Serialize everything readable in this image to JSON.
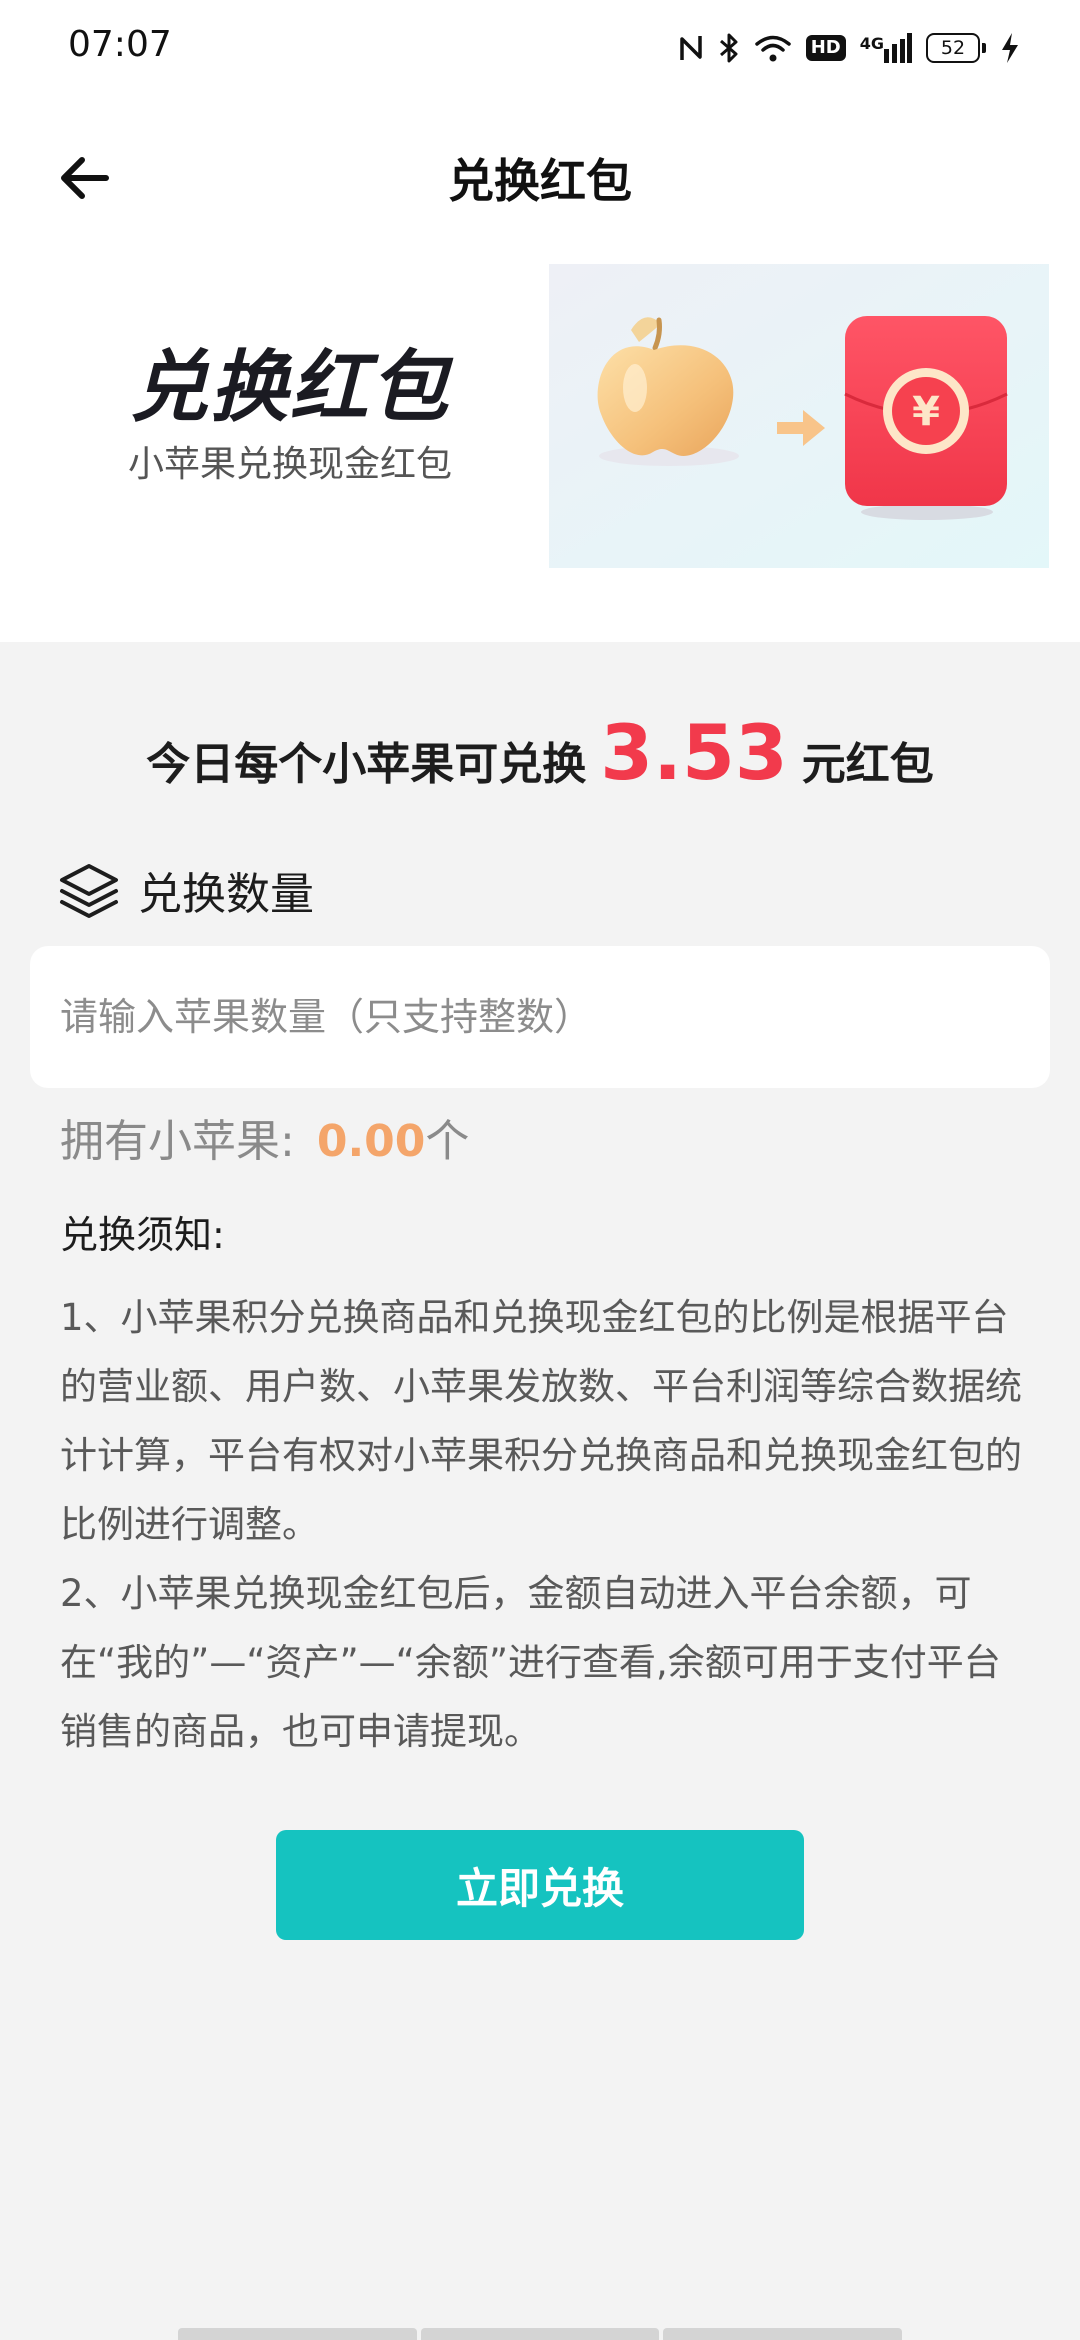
{
  "status_bar": {
    "time": "07:07",
    "icons": [
      "nfc-icon",
      "bluetooth-icon",
      "wifi-icon",
      "hd-icon",
      "cellular-4g-icon",
      "battery-icon",
      "charging-icon"
    ],
    "hd_label": "HD",
    "network_label": "4G",
    "battery_level": "52"
  },
  "header": {
    "back_icon": "arrow-left-icon",
    "title": "兑换红包"
  },
  "banner": {
    "title": "兑换红包",
    "subtitle": "小苹果兑换现金红包",
    "image_icons": [
      "apple-icon",
      "arrow-right-icon",
      "red-envelope-icon"
    ],
    "envelope_symbol": "¥"
  },
  "rate": {
    "prefix": "今日每个小苹果可兑换",
    "value": "3.53",
    "suffix": "元红包"
  },
  "section": {
    "icon": "layers-icon",
    "label": "兑换数量"
  },
  "quantity_input": {
    "value": "",
    "placeholder": "请输入苹果数量（只支持整数）"
  },
  "owned": {
    "label": "拥有小苹果:",
    "value": "0.00",
    "unit": "个"
  },
  "notice": {
    "title": "兑换须知:",
    "items": [
      "1、小苹果积分兑换商品和兑换现金红包的比例是根据平台的营业额、用户数、小苹果发放数、平台利润等综合数据统计计算，平台有权对小苹果积分兑换商品和兑换现金红包的比例进行调整。",
      "2、小苹果兑换现金红包后，金额自动进入平台余额，可在“我的”—“资产”—“余额”进行查看,余额可用于支付平台销售的商品，也可申请提现。"
    ]
  },
  "action": {
    "button_label": "立即兑换"
  },
  "colors": {
    "accent_teal": "#15c3c0",
    "highlight_red": "#f23a4c",
    "owned_orange": "#f4a56a",
    "background": "#f3f3f3"
  }
}
